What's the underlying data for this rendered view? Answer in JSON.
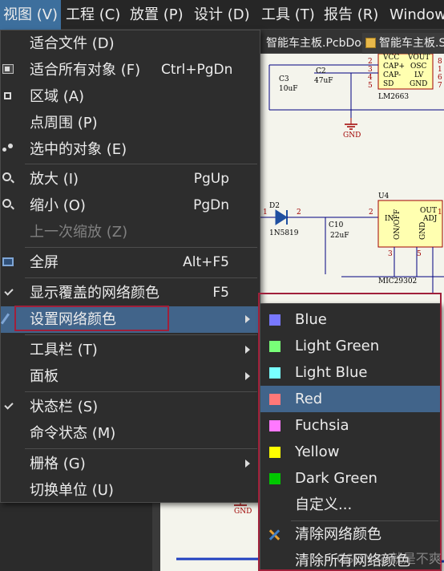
{
  "menubar": {
    "items": [
      {
        "label": "视图 (V)"
      },
      {
        "label": "工程 (C)"
      },
      {
        "label": "放置 (P)"
      },
      {
        "label": "设计 (D)"
      },
      {
        "label": "工具 (T)"
      },
      {
        "label": "报告 (R)"
      },
      {
        "label": "Window"
      }
    ]
  },
  "tabs": [
    {
      "label": "智能车主板.PcbDoc"
    },
    {
      "label": "智能车主板.S"
    }
  ],
  "schematic": {
    "u_top": {
      "pins": [
        "VCC",
        "VOUT",
        "CAP+",
        "OSC",
        "CAP-",
        "LV",
        "SD",
        "GND"
      ],
      "name": "LM2663",
      "pin_numbers": [
        "2",
        "3",
        "4",
        "5",
        "8",
        "1",
        "6",
        "7"
      ]
    },
    "c3": {
      "ref": "C3",
      "value": "10uF"
    },
    "c2": {
      "ref": "C2",
      "value": "47uF"
    },
    "gnd1": "GND",
    "d2": {
      "ref": "D2",
      "value": "1N5819",
      "pin_a": "1",
      "pin_b": "2"
    },
    "c10": {
      "ref": "C10",
      "value": "22uF"
    },
    "u4": {
      "ref": "U4",
      "name": "MIC29302",
      "pins": [
        "IN",
        "OUT",
        "ON/OFF",
        "ADJ",
        "GND"
      ],
      "pin_numbers": [
        "2",
        "1",
        "3",
        "5"
      ]
    },
    "gnd2": "GND"
  },
  "menu": {
    "items": [
      {
        "label": "适合文件 (D)",
        "shortcut": ""
      },
      {
        "label": "适合所有对象 (F)",
        "shortcut": "Ctrl+PgDn"
      },
      {
        "label": "区域 (A)",
        "shortcut": ""
      },
      {
        "label": "点周围 (P)",
        "shortcut": ""
      },
      {
        "label": "选中的对象 (E)",
        "shortcut": ""
      },
      {
        "label": "放大 (I)",
        "shortcut": "PgUp"
      },
      {
        "label": "缩小 (O)",
        "shortcut": "PgDn"
      },
      {
        "label": "上一次缩放 (Z)",
        "shortcut": ""
      },
      {
        "label": "全屏",
        "shortcut": "Alt+F5"
      },
      {
        "label": "显示覆盖的网络颜色",
        "shortcut": "F5"
      },
      {
        "label": "设置网络颜色",
        "shortcut": ""
      },
      {
        "label": "工具栏 (T)",
        "shortcut": ""
      },
      {
        "label": "面板",
        "shortcut": ""
      },
      {
        "label": "状态栏 (S)",
        "shortcut": ""
      },
      {
        "label": "命令状态 (M)",
        "shortcut": ""
      },
      {
        "label": "栅格 (G)",
        "shortcut": ""
      },
      {
        "label": "切换单位 (U)",
        "shortcut": ""
      }
    ]
  },
  "submenu": {
    "items": [
      {
        "label": "Blue",
        "color": "#7878ff"
      },
      {
        "label": "Light Green",
        "color": "#78ff78"
      },
      {
        "label": "Light Blue",
        "color": "#78ffff"
      },
      {
        "label": "Red",
        "color": "#ff7878"
      },
      {
        "label": "Fuchsia",
        "color": "#ff78ff"
      },
      {
        "label": "Yellow",
        "color": "#ffff00"
      },
      {
        "label": "Dark Green",
        "color": "#00c800"
      },
      {
        "label": "自定义...",
        "color": ""
      },
      {
        "label": "清除网络颜色",
        "color": ""
      },
      {
        "label": "清除所有网络颜色",
        "color": ""
      }
    ]
  },
  "watermark": "CSDN @就是不爽",
  "colors": {
    "highlight": "#41648a",
    "annotation_box": "#a0203a",
    "menu_bg": "#2d2d2d"
  }
}
